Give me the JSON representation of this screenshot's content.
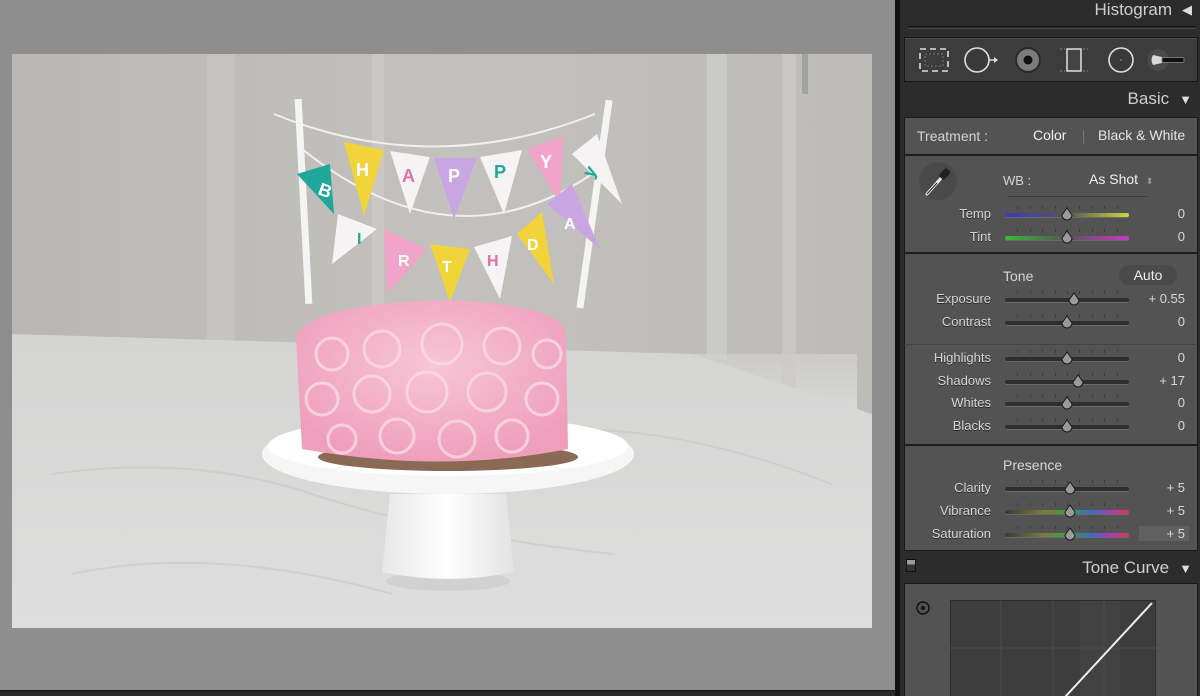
{
  "canvas": {
    "photo_description": "Pink rosette frosted cake on white cake stand with Happy Birthday bunting topper",
    "bunting_top_letters": [
      "B",
      "H",
      "A",
      "P",
      "P",
      "Y"
    ],
    "bunting_bottom_letters": [
      "I",
      "R",
      "T",
      "H",
      "D",
      "A",
      "Y"
    ]
  },
  "panel": {
    "histogram": {
      "title": "Histogram",
      "toggle_icon": "triangle-left-icon"
    },
    "tools": [
      {
        "name": "crop-overlay-tool",
        "icon": "crop-icon"
      },
      {
        "name": "spot-removal-tool",
        "icon": "spot-removal-icon"
      },
      {
        "name": "red-eye-tool",
        "icon": "red-eye-icon"
      },
      {
        "name": "graduated-filter-tool",
        "icon": "graduated-filter-icon"
      },
      {
        "name": "radial-filter-tool",
        "icon": "radial-filter-icon"
      },
      {
        "name": "adjustment-brush-tool",
        "icon": "brush-icon"
      }
    ],
    "basic": {
      "title": "Basic",
      "toggle_icon": "triangle-down-icon",
      "treatment_label": "Treatment :",
      "treatment_options": [
        "Color",
        "Black & White"
      ],
      "treatment_selected": "Color",
      "wb_label": "WB :",
      "wb_value": "As Shot",
      "tone_label": "Tone",
      "auto_label": "Auto",
      "presence_label": "Presence",
      "sliders": {
        "temp": {
          "label": "Temp",
          "value": "0",
          "position": 0.5,
          "track": "temp"
        },
        "tint": {
          "label": "Tint",
          "value": "0",
          "position": 0.5,
          "track": "tint"
        },
        "exposure": {
          "label": "Exposure",
          "value": "+ 0.55",
          "position": 0.555,
          "track": "plain"
        },
        "contrast": {
          "label": "Contrast",
          "value": "0",
          "position": 0.5,
          "track": "plain"
        },
        "highlights": {
          "label": "Highlights",
          "value": "0",
          "position": 0.5,
          "track": "plain"
        },
        "shadows": {
          "label": "Shadows",
          "value": "+ 17",
          "position": 0.585,
          "track": "plain"
        },
        "whites": {
          "label": "Whites",
          "value": "0",
          "position": 0.5,
          "track": "plain"
        },
        "blacks": {
          "label": "Blacks",
          "value": "0",
          "position": 0.5,
          "track": "plain"
        },
        "clarity": {
          "label": "Clarity",
          "value": "+ 5",
          "position": 0.525,
          "track": "plain"
        },
        "vibrance": {
          "label": "Vibrance",
          "value": "+ 5",
          "position": 0.525,
          "track": "color"
        },
        "saturation": {
          "label": "Saturation",
          "value": "+ 5",
          "position": 0.525,
          "track": "color"
        }
      }
    },
    "tone_curve": {
      "title": "Tone Curve",
      "toggle_icon": "triangle-down-icon"
    }
  },
  "colors": {
    "panel_bg": "#2c2c2c",
    "section_bg": "#535353",
    "canvas_bg": "#8e8e8e",
    "text": "#d4d4d4"
  }
}
